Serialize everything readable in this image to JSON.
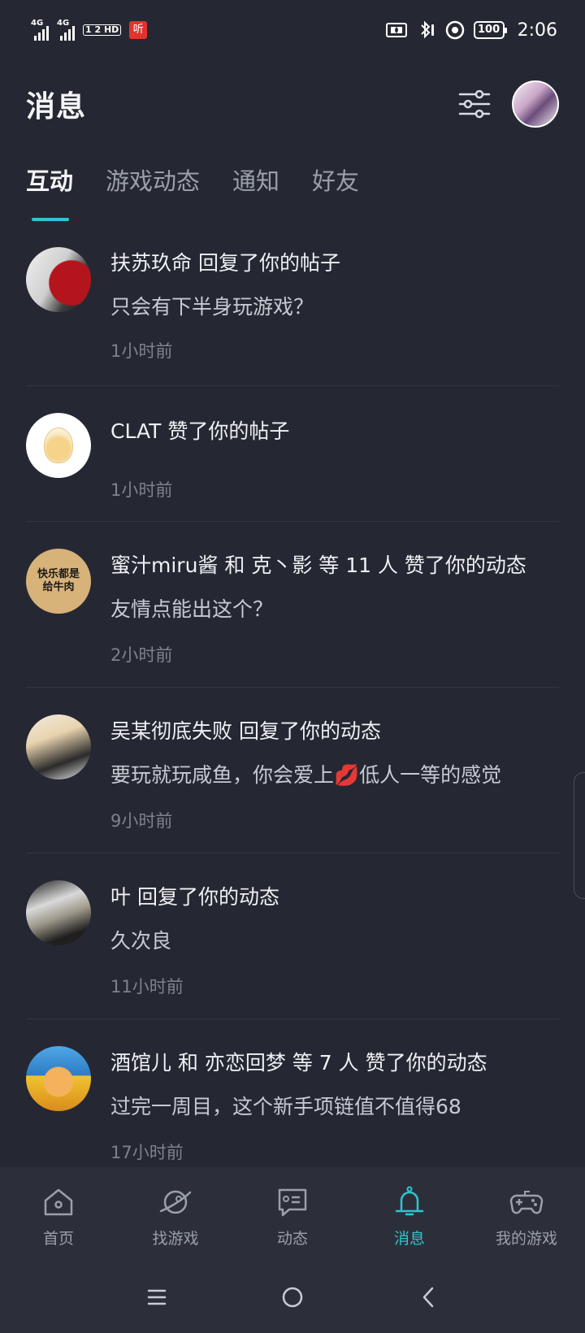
{
  "status_bar": {
    "net1": "4G",
    "net2": "4G",
    "hd_label": "1 2 HD",
    "ting_label": "听",
    "battery": "100",
    "time": "2:06"
  },
  "header": {
    "title": "消息"
  },
  "tabs": [
    {
      "label": "互动",
      "active": true
    },
    {
      "label": "游戏动态",
      "active": false
    },
    {
      "label": "通知",
      "active": false
    },
    {
      "label": "好友",
      "active": false
    }
  ],
  "messages": [
    {
      "title": "扶苏玖命 回复了你的帖子",
      "subtitle": "只会有下半身玩游戏？",
      "time": "1小时前"
    },
    {
      "title": "CLAT 赞了你的帖子",
      "subtitle": "",
      "time": "1小时前"
    },
    {
      "title": "蜜汁miru酱 和 克丶影 等 11 人 赞了你的动态",
      "subtitle": "友情点能出这个？",
      "time": "2小时前",
      "avatar_text": "快乐都是给牛肉"
    },
    {
      "title": "吴某彻底失败 回复了你的动态",
      "subtitle": "要玩就玩咸鱼，你会爱上💋低人一等的感觉",
      "time": "9小时前"
    },
    {
      "title": "叶 回复了你的动态",
      "subtitle": "久次良",
      "time": "11小时前"
    },
    {
      "title": "酒馆儿 和 亦恋回梦 等 7 人 赞了你的动态",
      "subtitle": "过完一周目，这个新手项链值不值得68",
      "time": "17小时前"
    }
  ],
  "bottom_nav": [
    {
      "label": "首页",
      "icon": "home-icon",
      "active": false
    },
    {
      "label": "找游戏",
      "icon": "planet-icon",
      "active": false
    },
    {
      "label": "动态",
      "icon": "feed-icon",
      "active": false
    },
    {
      "label": "消息",
      "icon": "bell-icon",
      "active": true
    },
    {
      "label": "我的游戏",
      "icon": "gamepad-icon",
      "active": false
    }
  ],
  "colors": {
    "background": "#252832",
    "accent": "#2ec5cf",
    "nav_background": "#2c2f3a"
  }
}
